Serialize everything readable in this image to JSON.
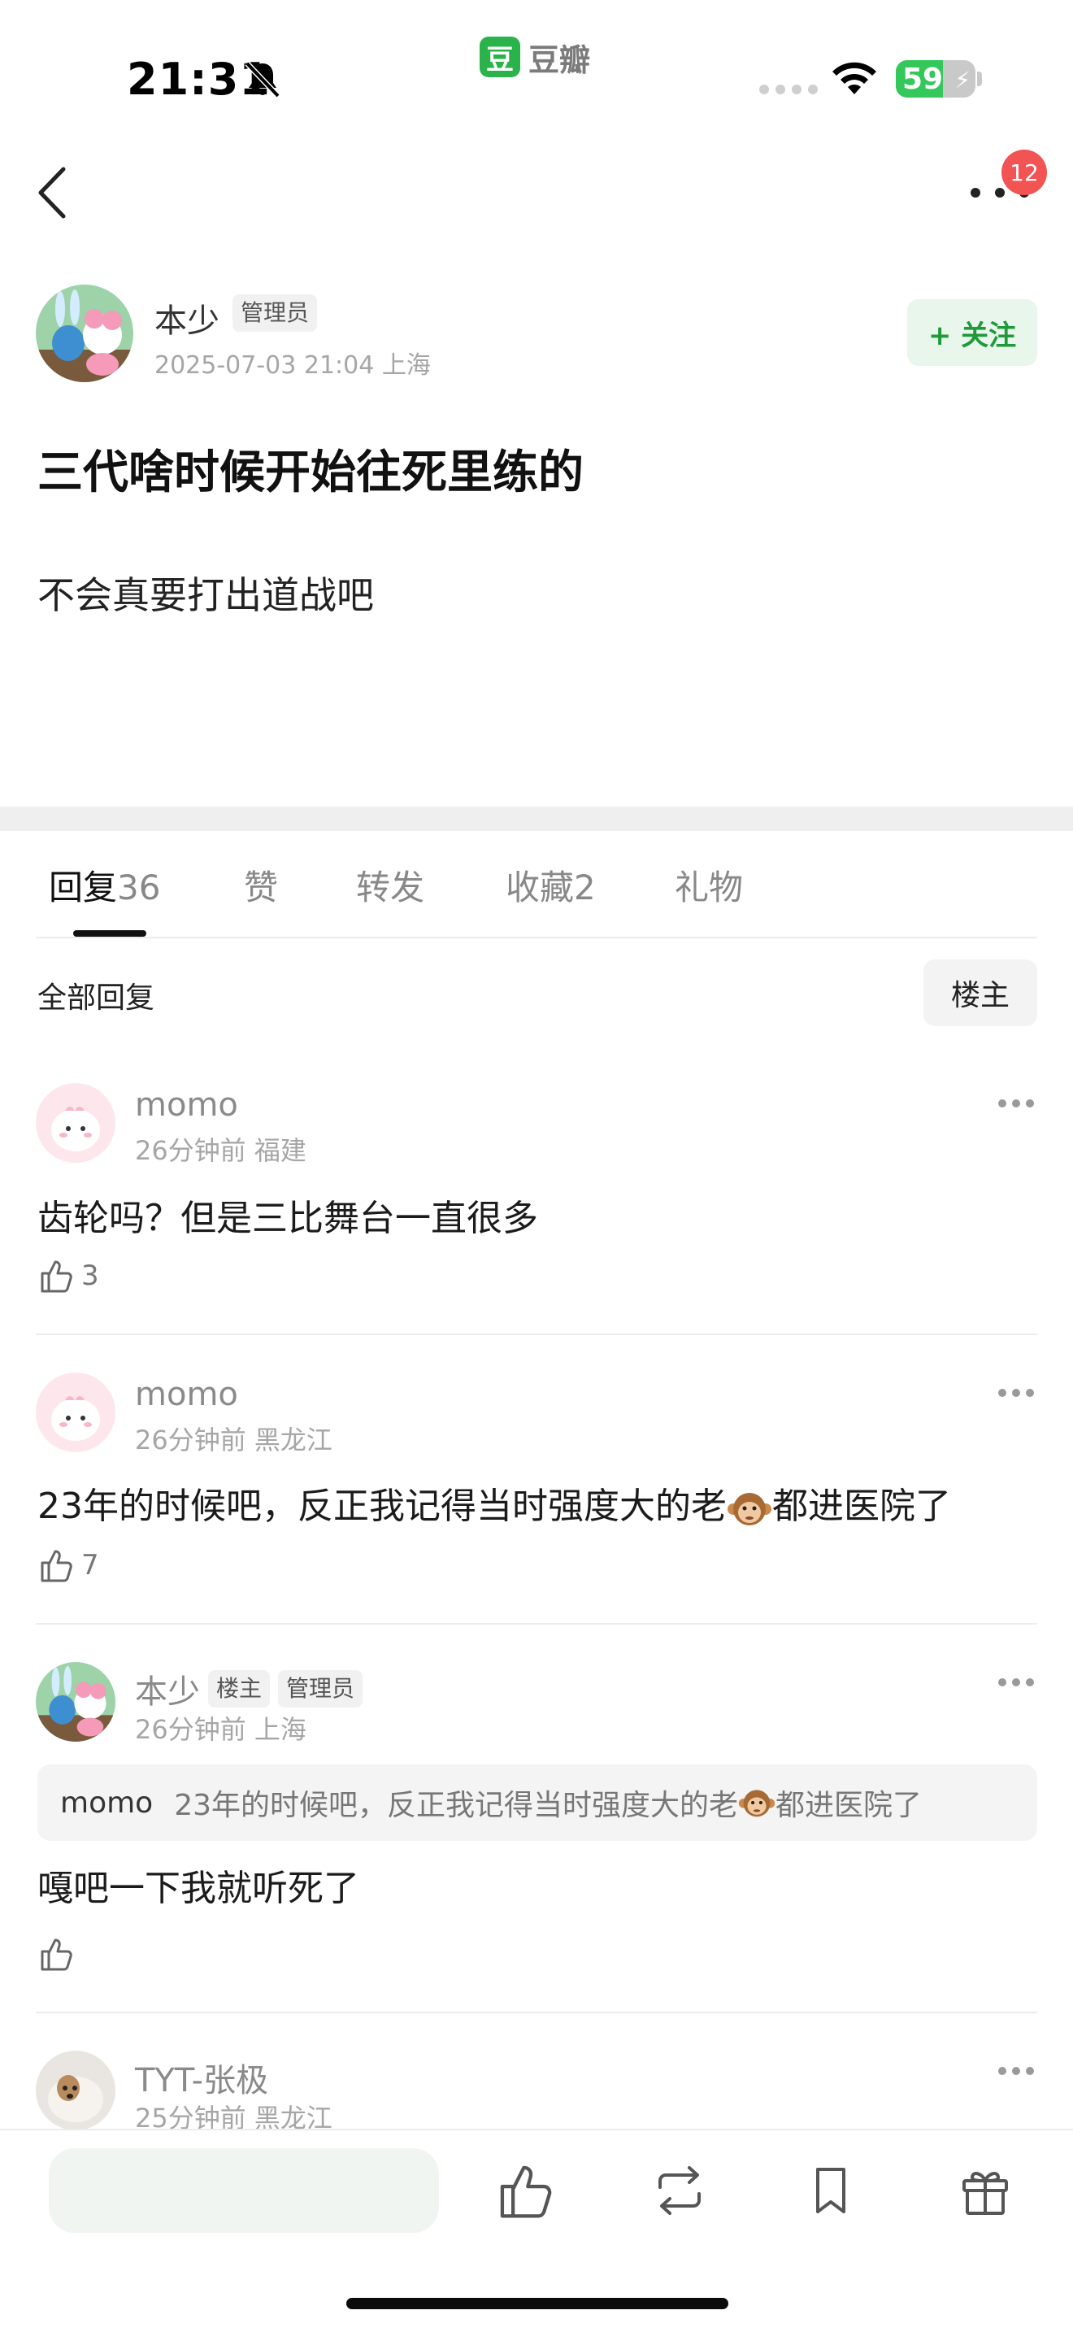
{
  "status_bar": {
    "time": "21:31",
    "app_logo_text": "豆",
    "app_name": "豆瓣",
    "battery_level": "59",
    "battery_fraction": 0.59
  },
  "nav": {
    "notification_count": "12"
  },
  "post": {
    "author_name": "本少",
    "author_tag": "管理员",
    "meta": "2025-07-03 21:04  上海",
    "follow_label": "+ 关注",
    "title": "三代啥时候开始往死里练的",
    "body": "不会真要打出道战吧"
  },
  "tabs": [
    {
      "label": "回复",
      "count": "36"
    },
    {
      "label": "赞",
      "count": ""
    },
    {
      "label": "转发",
      "count": ""
    },
    {
      "label": "收藏",
      "count": "2"
    },
    {
      "label": "礼物",
      "count": ""
    }
  ],
  "replies_header": {
    "label": "全部回复",
    "filter": "楼主"
  },
  "comments": [
    {
      "name": "momo",
      "meta": "26分钟前  福建",
      "text": "齿轮吗？但是三比舞台一直很多",
      "likes": "3"
    },
    {
      "name": "momo",
      "meta": "26分钟前  黑龙江",
      "text_before": "23年的时候吧，反正我记得当时强度大的老",
      "text_after": "都进医院了",
      "likes": "7"
    },
    {
      "name": "本少",
      "tag1": "楼主",
      "tag2": "管理员",
      "meta": "26分钟前  上海",
      "quote_author": "momo",
      "quote_before": "23年的时候吧，反正我记得当时强度大的老",
      "quote_after": "都进医院了",
      "text": "嘎吧一下我就听死了",
      "likes": ""
    },
    {
      "name": "TYT-张极",
      "meta": "25分钟前  黑龙江"
    }
  ],
  "colors": {
    "accent_green": "#1f9a3a",
    "follow_bg": "#e9f6ec",
    "badge_red": "#f25353"
  },
  "icons": [
    "bell-slash-icon",
    "wifi-icon",
    "battery-icon",
    "back-arrow-icon",
    "more-icon",
    "thumbs-up-icon",
    "repost-icon",
    "bookmark-icon",
    "gift-icon",
    "monkey-emoji-icon"
  ]
}
